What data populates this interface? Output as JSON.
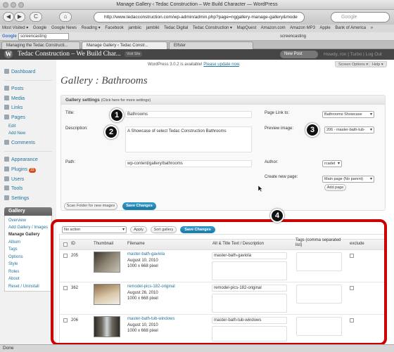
{
  "browser": {
    "window_title": "Manage Gallery ‹ Tedac Construction – We Build Character — WordPress",
    "back": "◀",
    "forward": "▶",
    "reload": "C",
    "home": "⌂",
    "url": "http://www.tedacconstruction.com/wp-admin/admin.php?page=nggallery-manage-gallery&mode",
    "search_placeholder": "Google",
    "bookmarks": [
      "Most Visited ▾",
      "Google",
      "Google News",
      "Reading ▾",
      "Facebook",
      "jambiic",
      "jambiki",
      "Tedac Digital",
      "Tedac Construction ▾",
      "MapQuest",
      "Amazon.com",
      "Amazon MP3",
      "Apple",
      "Bank of America",
      "»"
    ],
    "google_label": "Google",
    "google_query": "screencasting",
    "google_tail": "screencasting",
    "tabs": [
      "Managing the Tedac Constructi...",
      "Manage Gallery ‹ Tedac Constr...",
      "Elfster"
    ],
    "status": "Done"
  },
  "wp_header": {
    "site_title": "Tedac Construction – We Build Char...",
    "visit_site": "Visit Site",
    "new_post": "New Post",
    "howdy": "Howdy, ron | Turbo | Log Out"
  },
  "sidebar": {
    "dashboard": "Dashboard",
    "posts": "Posts",
    "media": "Media",
    "links": "Links",
    "pages": "Pages",
    "pages_sub": [
      "Edit",
      "Add New"
    ],
    "comments": "Comments",
    "appearance": "Appearance",
    "plugins": "Plugins",
    "plugins_badge": "15",
    "users": "Users",
    "tools": "Tools",
    "settings": "Settings",
    "gallery": "Gallery",
    "gallery_sub": [
      "Overview",
      "Add Gallery / Images",
      "Manage Gallery",
      "Album",
      "Tags",
      "Options",
      "Style",
      "Roles",
      "About",
      "Reset / Uninstall"
    ]
  },
  "notice": {
    "prefix": "WordPress 3.0.2 is available! ",
    "link": "Please update now",
    "suffix": "."
  },
  "screen_options": "Screen Options ▾",
  "help": "Help ▾",
  "page_title": "Gallery : Bathrooms",
  "settings": {
    "heading": "Gallery settings",
    "heading_hint": "(Click here for more settings)",
    "title_label": "Title:",
    "title_value": "Bathrooms",
    "description_label": "Description:",
    "description_value": "A Showcase of select Tedac Construction Bathrooms",
    "path_label": "Path:",
    "path_value": "wp-content/gallery/bathrooms",
    "page_link_label": "Page Link to:",
    "page_link_value": "Bathrooms Showcase",
    "preview_label": "Preview image:",
    "preview_value": "206 - master-bath-tub-",
    "author_label": "Author:",
    "author_value": "rcadet",
    "new_page_label": "Create new page:",
    "new_page_value": "Main page (No parent)",
    "add_page": "Add page",
    "scan_folder": "Scan Folder for new images",
    "save": "Save Changes"
  },
  "callouts": [
    "1",
    "2",
    "3",
    "4"
  ],
  "bulk": {
    "action": "No action",
    "apply": "Apply",
    "sort": "Sort gallery",
    "save": "Save Changes"
  },
  "table": {
    "headers": [
      "ID",
      "Thumbnail",
      "Filename",
      "Alt & Title Text / Description",
      "Tags (comma separated list)",
      "exclude"
    ],
    "rows": [
      {
        "id": "205",
        "filename": "master-bath-gaviola",
        "date": "August 10, 2010",
        "size": "1000 x 668 pixel",
        "alt": "master-bath-gaviola"
      },
      {
        "id": "362",
        "filename": "remodel-pics-182-original",
        "date": "August 26, 2010",
        "size": "1000 x 668 pixel",
        "alt": "remodel-pics-182-original"
      },
      {
        "id": "206",
        "filename": "master-bath-tub-windows",
        "date": "August 10, 2010",
        "size": "1000 x 668 pixel",
        "alt": "master-bath-tub-windows"
      }
    ]
  },
  "colors": {
    "accent": "#21759b",
    "highlight": "#cc0000",
    "header": "#464646"
  }
}
